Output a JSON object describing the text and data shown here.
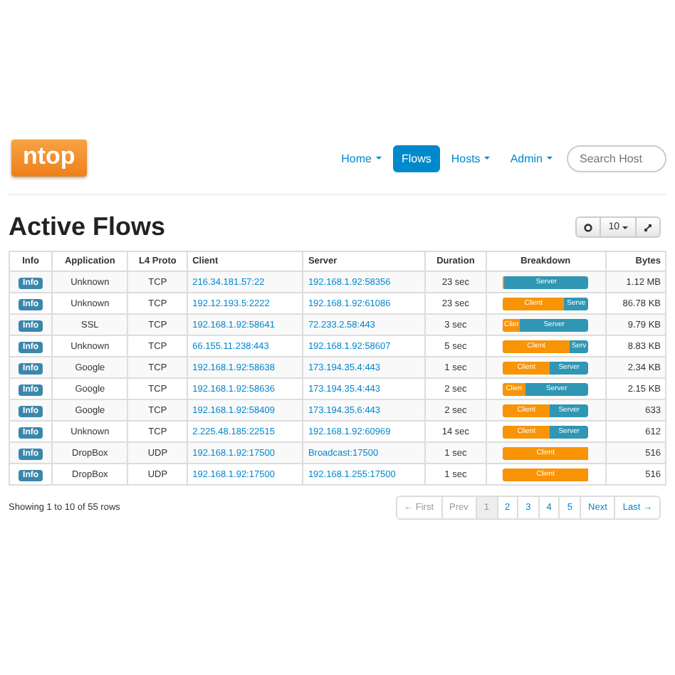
{
  "brand": {
    "logo": "ntop"
  },
  "nav": [
    {
      "label": "Home",
      "dropdown": true,
      "selected": false
    },
    {
      "label": "Flows",
      "dropdown": false,
      "selected": true
    },
    {
      "label": "Hosts",
      "dropdown": true,
      "selected": false
    },
    {
      "label": "Admin",
      "dropdown": true,
      "selected": false
    }
  ],
  "search": {
    "placeholder": "Search Host"
  },
  "title": "Active Flows",
  "toolbar": {
    "page_size": "10"
  },
  "table": {
    "columns": [
      "Info",
      "Application",
      "L4 Proto",
      "Client",
      "Server",
      "Duration",
      "Breakdown",
      "Bytes"
    ],
    "rows": [
      {
        "info": "Info",
        "application": "Unknown",
        "proto": "TCP",
        "client": "216.34.181.57:22",
        "server": "192.168.1.92:58356",
        "duration": "23 sec",
        "breakdown": {
          "level": 0.02,
          "server": "Server"
        },
        "bytes": "1.12 MB"
      },
      {
        "info": "Info",
        "application": "Unknown",
        "proto": "TCP",
        "client": "192.12.193.5:2222",
        "server": "192.168.1.92:61086",
        "duration": "23 sec",
        "breakdown": {
          "level": 0.72,
          "client": "Client",
          "server": "Serve"
        },
        "bytes": "86.78 KB"
      },
      {
        "info": "Info",
        "application": "SSL",
        "proto": "TCP",
        "client": "192.168.1.92:58641",
        "server": "72.233.2.58:443",
        "duration": "3 sec",
        "breakdown": {
          "level": 0.2,
          "client": "Clier",
          "server": "Server"
        },
        "bytes": "9.79 KB"
      },
      {
        "info": "Info",
        "application": "Unknown",
        "proto": "TCP",
        "client": "66.155.11.238:443",
        "server": "192.168.1.92:58607",
        "duration": "5 sec",
        "breakdown": {
          "level": 0.78,
          "client": "Client",
          "server": "Serv"
        },
        "bytes": "8.83 KB"
      },
      {
        "info": "Info",
        "application": "Google",
        "proto": "TCP",
        "client": "192.168.1.92:58638",
        "server": "173.194.35.4:443",
        "duration": "1 sec",
        "breakdown": {
          "level": 0.55,
          "client": "Client",
          "server": "Server"
        },
        "bytes": "2.34 KB"
      },
      {
        "info": "Info",
        "application": "Google",
        "proto": "TCP",
        "client": "192.168.1.92:58636",
        "server": "173.194.35.4:443",
        "duration": "2 sec",
        "breakdown": {
          "level": 0.26,
          "client": "Clien",
          "server": "Server"
        },
        "bytes": "2.15 KB"
      },
      {
        "info": "Info",
        "application": "Google",
        "proto": "TCP",
        "client": "192.168.1.92:58409",
        "server": "173.194.35.6:443",
        "duration": "2 sec",
        "breakdown": {
          "level": 0.55,
          "client": "Client",
          "server": "Server"
        },
        "bytes": "633"
      },
      {
        "info": "Info",
        "application": "Unknown",
        "proto": "TCP",
        "client": "2.225.48.185:22515",
        "server": "192.168.1.92:60969",
        "duration": "14 sec",
        "breakdown": {
          "level": 0.55,
          "client": "Client",
          "server": "Server"
        },
        "bytes": "612"
      },
      {
        "info": "Info",
        "application": "DropBox",
        "proto": "UDP",
        "client": "192.168.1.92:17500",
        "server": "Broadcast:17500",
        "duration": "1 sec",
        "breakdown": {
          "level": 1,
          "client": "Client"
        },
        "bytes": "516"
      },
      {
        "info": "Info",
        "application": "DropBox",
        "proto": "UDP",
        "client": "192.168.1.92:17500",
        "server": "192.168.1.255:17500",
        "duration": "1 sec",
        "breakdown": {
          "level": 1,
          "client": "Client"
        },
        "bytes": "516"
      }
    ]
  },
  "footer": "Showing 1 to 10 of 55 rows",
  "pagination": [
    {
      "label": "← First",
      "disabled": true,
      "selected": false
    },
    {
      "label": "Prev",
      "disabled": true,
      "selected": false
    },
    {
      "label": "1",
      "disabled": true,
      "selected": true
    },
    {
      "label": "2",
      "disabled": false,
      "selected": false
    },
    {
      "label": "3",
      "disabled": false,
      "selected": false
    },
    {
      "label": "4",
      "disabled": false,
      "selected": false
    },
    {
      "label": "5",
      "disabled": false,
      "selected": false
    },
    {
      "label": "Next",
      "disabled": false,
      "selected": false
    },
    {
      "label": "Last →",
      "disabled": false,
      "selected": false
    }
  ]
}
